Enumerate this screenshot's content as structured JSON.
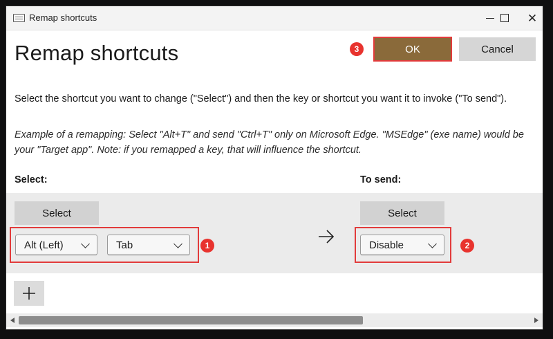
{
  "window": {
    "title": "Remap shortcuts",
    "controls": {
      "minimize": "minimize",
      "maximize": "maximize",
      "close": "✕"
    }
  },
  "header": {
    "title": "Remap shortcuts",
    "ok_label": "OK",
    "cancel_label": "Cancel",
    "ok_badge": "3"
  },
  "instructions": {
    "description": "Select the shortcut you want to change (\"Select\") and then the key or shortcut you want it to invoke (\"To send\").",
    "example": "Example of a remapping: Select \"Alt+T\" and send \"Ctrl+T\" only on Microsoft Edge. \"MSEdge\" (exe name) would be your \"Target app\". Note: if you remapped a key, that will influence the shortcut."
  },
  "columns": {
    "select_label": "Select:",
    "to_send_label": "To send:"
  },
  "row": {
    "select_button": "Select",
    "send_select_button": "Select",
    "select_keys": [
      "Alt (Left)",
      "Tab"
    ],
    "select_badge": "1",
    "send_key": "Disable",
    "send_badge": "2",
    "arrow_icon": "arrow-right-icon"
  },
  "footer": {
    "add_icon": "plus-icon"
  },
  "colors": {
    "ok_button": "#8a6a3a",
    "highlight": "#e23b3b",
    "badge": "#e8332e"
  }
}
